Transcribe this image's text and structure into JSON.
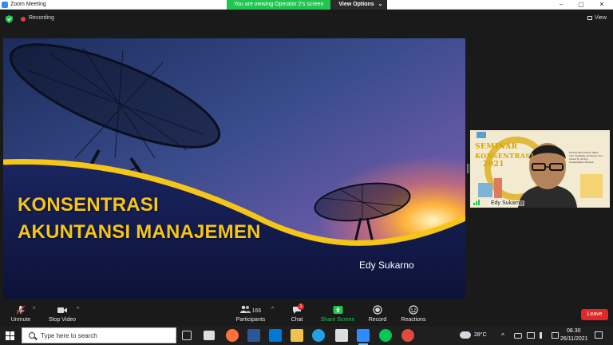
{
  "window": {
    "title": "Zoom Meeting",
    "minimize": "–",
    "maximize": "▢",
    "close": "✕"
  },
  "banner": {
    "viewing_text": "You are viewing Operator 2's screen",
    "view_options_label": "View Options",
    "view_options_caret": "⌄"
  },
  "topbar": {
    "recording_label": "Recording",
    "view_label": "View"
  },
  "slide": {
    "title_line1": "KONSENTRASI",
    "title_line2": "AKUNTANSI MANAJEMEN",
    "author": "Edy Sukarno"
  },
  "thumbnail": {
    "seminar_line1": "SEMINAR",
    "seminar_line2": "KONSENTRASI",
    "seminar_line3": "2021",
    "small_text": "Find the Best Career, Make Your Capability, and Enjoy Your Career by Joining Concentration Seminar",
    "participant_name": "Edy Sukarno"
  },
  "toolbar": {
    "unmute_label": "Unmute",
    "stop_video_label": "Stop Video",
    "participants_count": "166",
    "participants_label": "Participants",
    "chat_label": "Chat",
    "chat_badge": "1",
    "share_screen_label": "Share Screen",
    "record_label": "Record",
    "reactions_label": "Reactions",
    "leave_label": "Leave",
    "caret": "^"
  },
  "taskbar": {
    "search_placeholder": "Type here to search",
    "temperature": "28°C",
    "time": "08.30",
    "date": "26/11/2021"
  },
  "colors": {
    "zoom_blue": "#2d8cff",
    "banner_green": "#23c552",
    "slide_title_yellow": "#f5c518",
    "leave_red": "#e02828",
    "share_green": "#23c552"
  },
  "icons": {
    "app": "zoom-icon",
    "shield": "shield-icon",
    "mic_muted": "mic-muted-icon",
    "video": "video-camera-icon",
    "participants": "participants-icon",
    "chat": "chat-bubble-icon",
    "share": "share-screen-icon",
    "record": "record-icon",
    "reactions": "smiley-icon"
  }
}
